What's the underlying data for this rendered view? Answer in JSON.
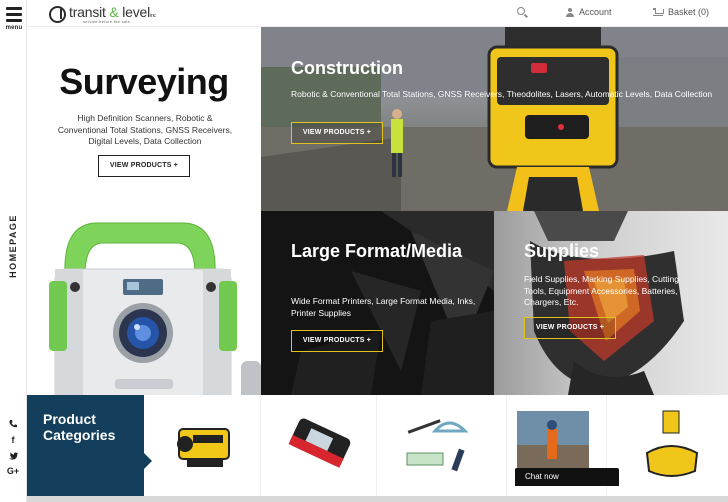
{
  "app": {
    "title": "transit & level",
    "brand_tagline": "service before the sale"
  },
  "nav": {
    "menu_label": "menu",
    "homepage_label": "HOMEPAGE",
    "account_label": "Account",
    "basket_label": "Basket (0)",
    "social": [
      "phone",
      "f",
      "twitter",
      "G+"
    ]
  },
  "hero": {
    "title": "Surveying",
    "description": "High Definition Scanners, Robotic & Conventional Total Stations, GNSS Receivers, Digital Levels, Data Collection",
    "button": "VIEW PRODUCTS +"
  },
  "tiles": {
    "construction": {
      "title": "Construction",
      "description": "Robotic & Conventional Total Stations, GNSS Receivers, Theodolites, Lasers, Automatic Levels, Data Collection",
      "button": "VIEW PRODUCTS +"
    },
    "large_format": {
      "title": "Large Format/Media",
      "description": "Wide Format Printers, Large Format Media, Inks, Printer Supplies",
      "button": "VIEW PRODUCTS +"
    },
    "supplies": {
      "title": "Supplies",
      "description": "Field Supplies, Marking Supplies, Cutting Tools, Equipment Accessories, Batteries, Chargers, Etc.",
      "button": "VIEW PRODUCTS +"
    }
  },
  "categories": {
    "label": "Product Categories"
  },
  "chat": {
    "label": "Chat now"
  },
  "colors": {
    "accent_yellow": "#e4c21c",
    "category_blue": "#143f5c",
    "brand_green": "#5ab848"
  }
}
